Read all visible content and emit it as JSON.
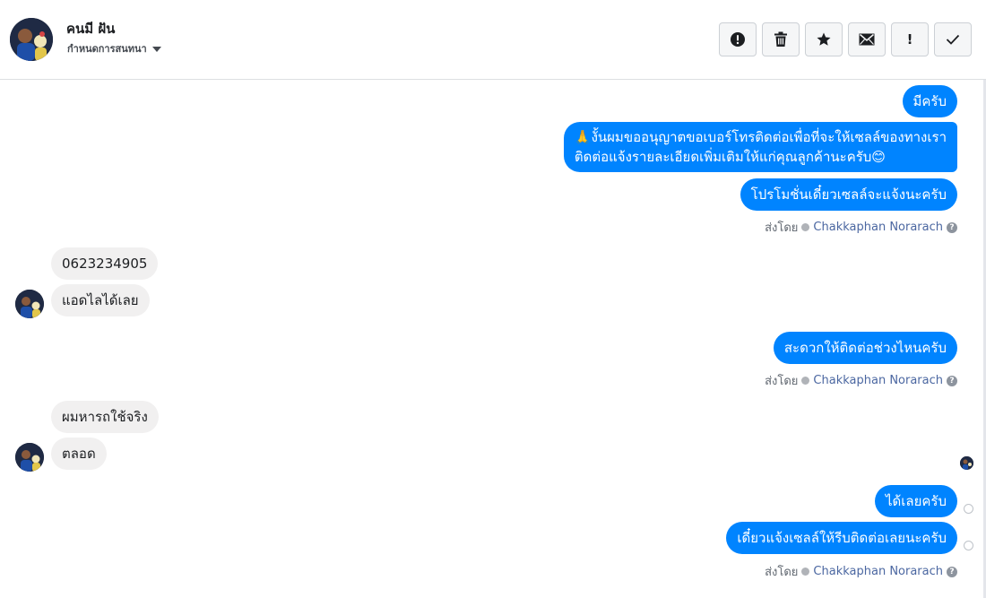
{
  "header": {
    "contact_name": "คนมี ฝัน",
    "assign_label": "กำหนดการสนทนา",
    "toolbar": [
      {
        "name": "spam-button",
        "icon": "alert-circle-icon"
      },
      {
        "name": "delete-button",
        "icon": "trash-icon"
      },
      {
        "name": "star-button",
        "icon": "star-icon"
      },
      {
        "name": "mark-unread-button",
        "icon": "envelope-icon"
      },
      {
        "name": "follow-up-button",
        "icon": "exclamation-icon"
      },
      {
        "name": "mark-done-button",
        "icon": "check-icon"
      }
    ],
    "follow_up_glyph": "!"
  },
  "thread": {
    "msg_1": "มีครับ",
    "msg_2_line1": "🙏งั้นผมขออนุญาตขอเบอร์โทรติดต่อเพื่อที่จะให้เซลล์ของทางเรา",
    "msg_2_line2": "ติดต่อแจ้งรายละเอียดเพิ่มเติมให้แก่คุณลูกค้านะครับ😊",
    "msg_3": "โปรโมชั่นเดี๋ยวเซลล์จะแจ้งนะครับ",
    "msg_4": "0623234905",
    "msg_5": "แอดไลได้เลย",
    "msg_6": "สะดวกให้ติดต่อช่วงไหนครับ",
    "msg_7": "ผมหารถใช้จริง",
    "msg_8": "ตลอด",
    "msg_9": "ได้เลยครับ",
    "msg_10": "เดี๋ยวแจ้งเซลล์ให้รีบติดต่อเลยนะครับ",
    "sent_by_label": "ส่งโดย",
    "agent_name": "Chakkaphan Norarach",
    "help_glyph": "?"
  },
  "colors": {
    "outgoing_bubble": "#0084ff",
    "incoming_bubble": "#f1f0f0",
    "agent_link": "#4b67a1"
  }
}
